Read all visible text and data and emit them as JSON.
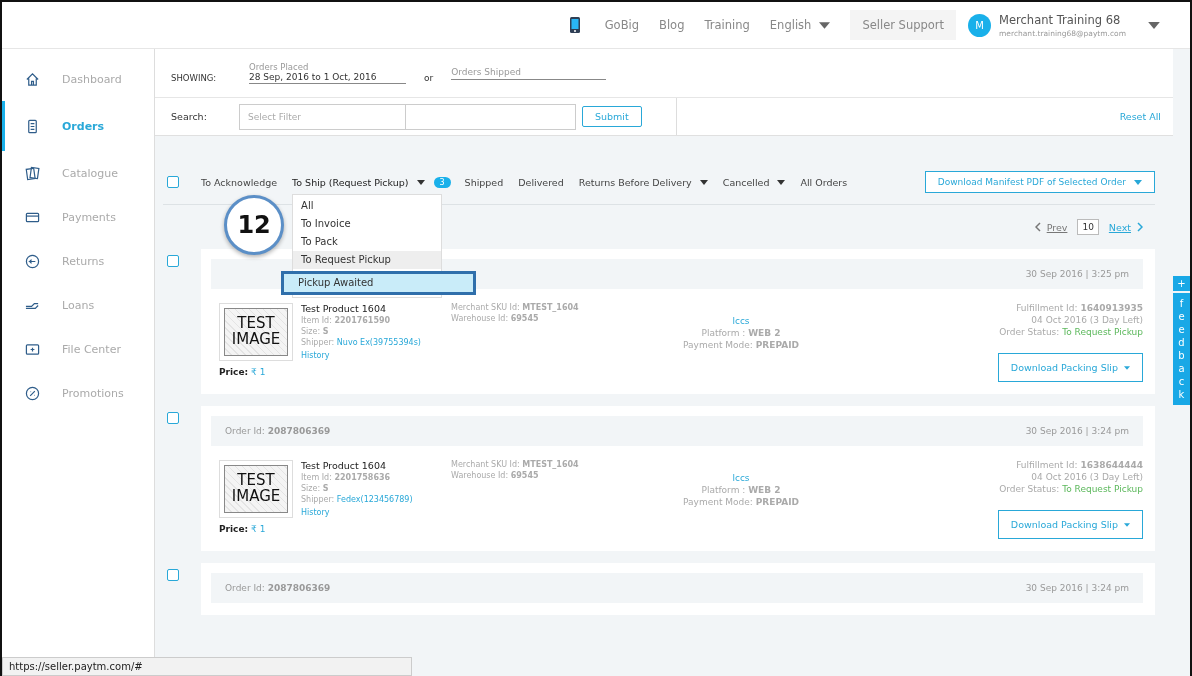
{
  "header": {
    "links": [
      "GoBig",
      "Blog",
      "Training"
    ],
    "language": "English",
    "support": "Seller Support",
    "user": {
      "initial": "M",
      "name": "Merchant Training 68",
      "email": "merchant.training68@paytm.com"
    }
  },
  "sidebar": {
    "items": [
      {
        "label": "Dashboard",
        "selected": false
      },
      {
        "label": "Orders",
        "selected": true
      },
      {
        "label": "Catalogue",
        "selected": false
      },
      {
        "label": "Payments",
        "selected": false
      },
      {
        "label": "Returns",
        "selected": false
      },
      {
        "label": "Loans",
        "selected": false
      },
      {
        "label": "File Center",
        "selected": false
      },
      {
        "label": "Promotions",
        "selected": false
      }
    ]
  },
  "filters": {
    "showing_label": "SHOWING:",
    "placed_label": "Orders Placed",
    "placed_value": "28 Sep, 2016 to 1 Oct, 2016",
    "or": "or",
    "shipped_placeholder": "Orders Shipped"
  },
  "search": {
    "label": "Search:",
    "filter_placeholder": "Select Filter",
    "submit": "Submit",
    "reset": "Reset All"
  },
  "select_all": {
    "checked": false
  },
  "tabs": [
    {
      "label": "To Acknowledge",
      "selected": false,
      "dropdown": false
    },
    {
      "label": "To Ship (Request Pickup)",
      "selected": true,
      "dropdown": true,
      "badge": "3"
    },
    {
      "label": "Shipped",
      "selected": false,
      "dropdown": false
    },
    {
      "label": "Delivered",
      "selected": false,
      "dropdown": false
    },
    {
      "label": "Returns Before Delivery",
      "selected": false,
      "dropdown": true
    },
    {
      "label": "Cancelled",
      "selected": false,
      "dropdown": true
    },
    {
      "label": "All Orders",
      "selected": false,
      "dropdown": false
    }
  ],
  "manifest_button": "Download Manifest PDF of Selected Order",
  "dropdown_menu": {
    "items": [
      {
        "label": "All",
        "selected": false,
        "hovered": false
      },
      {
        "label": "To Invoice",
        "selected": false,
        "hovered": false
      },
      {
        "label": "To Pack",
        "selected": false,
        "hovered": false
      },
      {
        "label": "To Request Pickup",
        "selected": false,
        "hovered": true
      },
      {
        "label": "Pickup Awaited",
        "selected": true,
        "hovered": false
      }
    ]
  },
  "callout": {
    "number": "12"
  },
  "pagination": {
    "prev": "Prev",
    "page": "10",
    "next": "Next"
  },
  "orders": [
    {
      "checked": false,
      "date": "30 Sep 2016 | 3:25 pm",
      "image_text": "TEST IMAGE",
      "product": "Test Product  1604",
      "item_id": "Item Id: **2201761590**",
      "size": "Size: **S**",
      "shipper_label": "Shipper:",
      "shipper": "Nuvo Ex(39755394s)",
      "history": "History",
      "sku": "Merchant SKU Id: **MTEST_1604**",
      "warehouse": "Warehouse Id: **69545**",
      "channel": "lccs",
      "platform": "Platform : **WEB 2**",
      "payment": "Payment Mode: **PREPAID**",
      "fulfillment": "Fulfillment Id: **1640913935**",
      "due": "04 Oct 2016 (3 Day Left)",
      "status_label": "Order Status:",
      "status": "To Request Pickup",
      "price_label": "Price:",
      "price": "₹ 1",
      "button": "Download Packing Slip"
    },
    {
      "checked": false,
      "order_id": "Order Id: **2087806369**",
      "date": "30 Sep 2016 | 3:24 pm",
      "image_text": "TEST IMAGE",
      "product": "Test Product  1604",
      "item_id": "Item Id: **2201758636**",
      "size": "Size: **S**",
      "shipper_label": "Shipper:",
      "shipper": "Fedex(123456789)",
      "history": "History",
      "sku": "Merchant SKU Id: **MTEST_1604**",
      "warehouse": "Warehouse Id: **69545**",
      "channel": "lccs",
      "platform": "Platform : **WEB 2**",
      "payment": "Payment Mode: **PREPAID**",
      "fulfillment": "Fulfillment Id: **1638644444**",
      "due": "04 Oct 2016 (3 Day Left)",
      "status_label": "Order Status:",
      "status": "To Request Pickup",
      "price_label": "Price:",
      "price": "₹ 1",
      "button": "Download Packing Slip"
    },
    {
      "checked": false,
      "order_id": "Order Id: **2087806369**",
      "date": "30 Sep 2016 | 3:24 pm"
    }
  ],
  "feedback": {
    "plus": "+",
    "label": "feedback"
  },
  "status_bar": "https://seller.paytm.com/#"
}
